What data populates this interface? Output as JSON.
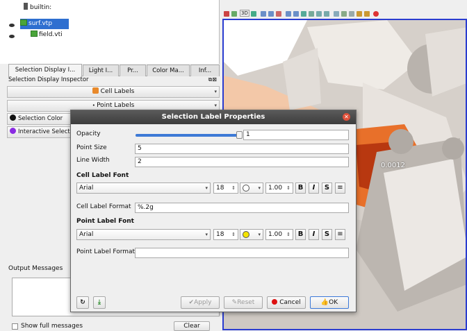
{
  "pipeline": {
    "items": [
      {
        "label": "builtin:"
      },
      {
        "label": "surf.vtp"
      },
      {
        "label": "field.vti"
      }
    ]
  },
  "tabs": [
    "Selection Display I...",
    "Light I...",
    "Pr...",
    "Color Ma...",
    "Inf..."
  ],
  "inspector": {
    "title": "Selection Display Inspector",
    "cell_labels_button": "Cell Labels",
    "point_labels_button": "Point Labels",
    "selection_color_button": "Selection Color",
    "interactive_selection_button": "Interactive Select"
  },
  "output": {
    "title": "Output Messages",
    "show_full_label": "Show full messages",
    "clear_label": "Clear"
  },
  "view": {
    "toolbar_text": "3D",
    "data_label": "0.0012"
  },
  "dialog": {
    "title": "Selection Label Properties",
    "opacity_label": "Opacity",
    "opacity_value": "1",
    "opacity_fraction": 1.0,
    "point_size_label": "Point Size",
    "point_size_value": "5",
    "line_width_label": "Line Width",
    "line_width_value": "2",
    "cell_font_heading": "Cell Label Font",
    "cell_font": {
      "family": "Arial",
      "size": "18",
      "opacity": "1.00",
      "color": "#ffffff"
    },
    "cell_format_label": "Cell Label Format",
    "cell_format_value": "%.2g",
    "point_font_heading": "Point Label Font",
    "point_font": {
      "family": "Arial",
      "size": "18",
      "opacity": "1.00",
      "color": "#f5e400"
    },
    "point_format_label": "Point Label Format",
    "point_format_value": "",
    "bold_label": "B",
    "italic_label": "I",
    "shadow_label": "S",
    "apply_label": "Apply",
    "reset_label": "Reset",
    "cancel_label": "Cancel",
    "ok_label": "OK"
  }
}
